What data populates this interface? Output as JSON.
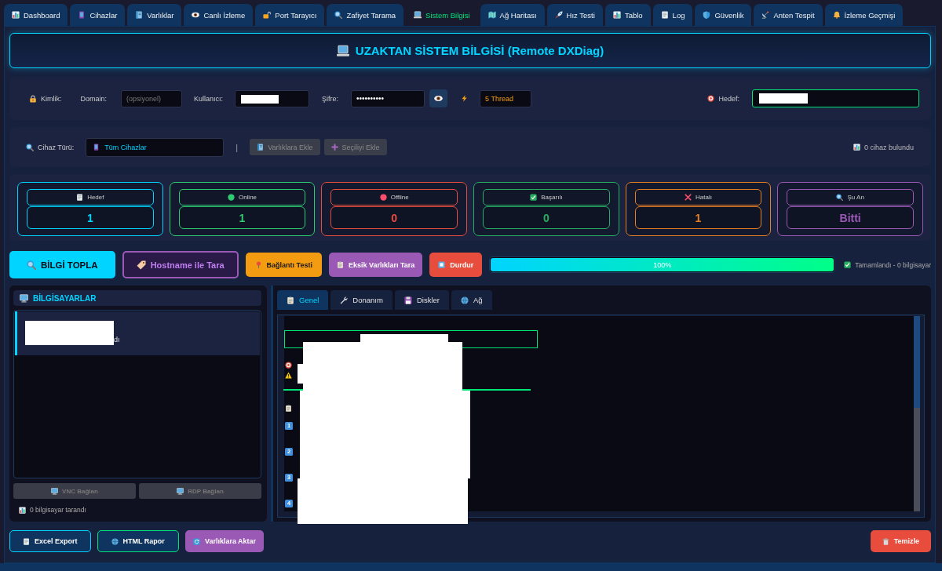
{
  "tabs": [
    {
      "label": "Dashboard",
      "selected": false
    },
    {
      "label": "Cihazlar",
      "selected": false
    },
    {
      "label": "Varlıklar",
      "selected": false
    },
    {
      "label": "Canlı İzleme",
      "selected": false
    },
    {
      "label": "Port Tarayıcı",
      "selected": false
    },
    {
      "label": "Zafiyet Tarama",
      "selected": false
    },
    {
      "label": "Sistem Bilgisi",
      "selected": true
    },
    {
      "label": "Ağ Haritası",
      "selected": false
    },
    {
      "label": "Hız Testi",
      "selected": false
    },
    {
      "label": "Tablo",
      "selected": false
    },
    {
      "label": "Log",
      "selected": false
    },
    {
      "label": "Güvenlik",
      "selected": false
    },
    {
      "label": "Anten Tespit",
      "selected": false
    },
    {
      "label": "İzleme Geçmişi",
      "selected": false
    }
  ],
  "title": "UZAKTAN SİSTEM BİLGİSİ (Remote DXDiag)",
  "credentials": {
    "label": "Kimlik:",
    "domain": {
      "label": "Domain:",
      "placeholder": "(opsiyonel)"
    },
    "username": {
      "label": "Kullanıcı:",
      "redacted": true
    },
    "password": {
      "label": "Şifre:",
      "value": "••••••••••"
    },
    "threads": {
      "value": "5 Thread"
    },
    "target": {
      "label": "Hedef:",
      "redacted": true
    }
  },
  "device_filter": {
    "label": "Cihaz Türü:",
    "value": "Tüm Cihazlar",
    "separator": "|",
    "buttons": [
      {
        "label": "Varlıklara Ekle",
        "disabled": true
      },
      {
        "label": "Seçiliyi Ekle",
        "disabled": true
      }
    ],
    "result": "0 cihaz bulundu"
  },
  "stats": [
    {
      "label": "Hedef",
      "value": "1",
      "color": "#00d4ff"
    },
    {
      "label": "Online",
      "value": "1",
      "color": "#2ecc71"
    },
    {
      "label": "Offline",
      "value": "0",
      "color": "#e74c3c"
    },
    {
      "label": "Başarılı",
      "value": "0",
      "color": "#27ae60"
    },
    {
      "label": "Hatalı",
      "value": "1",
      "color": "#e67e22"
    },
    {
      "label": "Şu An",
      "value": "Bitti",
      "color": "#9b59b6"
    }
  ],
  "actions": [
    {
      "label": "BİLGİ TOPLA",
      "kind": "primary"
    },
    {
      "label": "Hostname ile Tara",
      "kind": "outline"
    },
    {
      "label": "Bağlantı Testi",
      "kind": "warning"
    },
    {
      "label": "Eksik Varlıkları Tara",
      "kind": "secondary"
    },
    {
      "label": "Durdur",
      "kind": "danger"
    }
  ],
  "progress": {
    "level": 1,
    "label": "100%"
  },
  "status": {
    "checked": true,
    "text": "Tamamlandı - 0 bilgisayar"
  },
  "computers": {
    "title": "BİLGİSAYARLAR",
    "items": [
      {
        "text": "dı",
        "selected": true,
        "redacted": true
      }
    ],
    "buttons": [
      {
        "label": "VNC Bağlan",
        "disabled": true
      },
      {
        "label": "RDP Bağlan",
        "disabled": true
      }
    ],
    "footer": "0 bilgisayar tarandı"
  },
  "details": {
    "tabs": [
      {
        "label": "Genel",
        "selected": true
      },
      {
        "label": "Donanım",
        "selected": false
      },
      {
        "label": "Diskler",
        "selected": false
      },
      {
        "label": "Ağ",
        "selected": false
      }
    ],
    "numbered_items": [
      "1",
      "2",
      "3",
      "4"
    ],
    "redacted": true
  },
  "exports": [
    {
      "label": "Excel Export",
      "kind": "info"
    },
    {
      "label": "HTML Rapor",
      "kind": "success"
    },
    {
      "label": "Varlıklara Aktar",
      "kind": "secondary"
    }
  ],
  "clear_button": {
    "label": "Temizle",
    "kind": "danger"
  }
}
